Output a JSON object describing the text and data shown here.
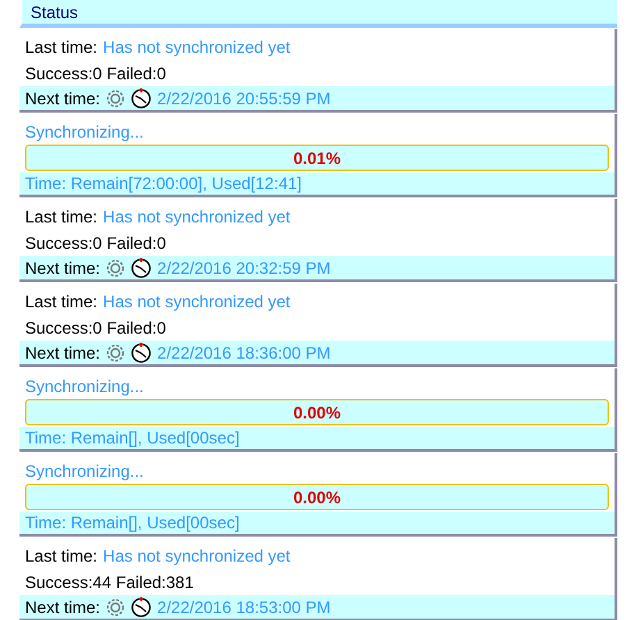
{
  "header": {
    "title": "Status"
  },
  "items": [
    {
      "kind": "idle",
      "last_label": "Last time:",
      "last_value": "Has not synchronized yet",
      "counts": "Success:0 Failed:0",
      "next_label": "Next time:",
      "next_value": "2/22/2016 20:55:59 PM"
    },
    {
      "kind": "sync",
      "status": "Synchronizing...",
      "percent": "0.01%",
      "time": "Time: Remain[72:00:00], Used[12:41]"
    },
    {
      "kind": "idle",
      "last_label": "Last time:",
      "last_value": "Has not synchronized yet",
      "counts": "Success:0 Failed:0",
      "next_label": "Next time:",
      "next_value": "2/22/2016 20:32:59 PM"
    },
    {
      "kind": "idle",
      "last_label": "Last time:",
      "last_value": "Has not synchronized yet",
      "counts": "Success:0 Failed:0",
      "next_label": "Next time:",
      "next_value": "2/22/2016 18:36:00 PM"
    },
    {
      "kind": "sync",
      "status": "Synchronizing...",
      "percent": "0.00%",
      "time": "Time: Remain[], Used[00sec]"
    },
    {
      "kind": "sync",
      "status": "Synchronizing...",
      "percent": "0.00%",
      "time": "Time: Remain[], Used[00sec]"
    },
    {
      "kind": "idle",
      "last_label": "Last time:",
      "last_value": "Has not synchronized yet",
      "counts": "Success:44 Failed:381",
      "next_label": "Next time:",
      "next_value": "2/22/2016 18:53:00 PM"
    }
  ]
}
